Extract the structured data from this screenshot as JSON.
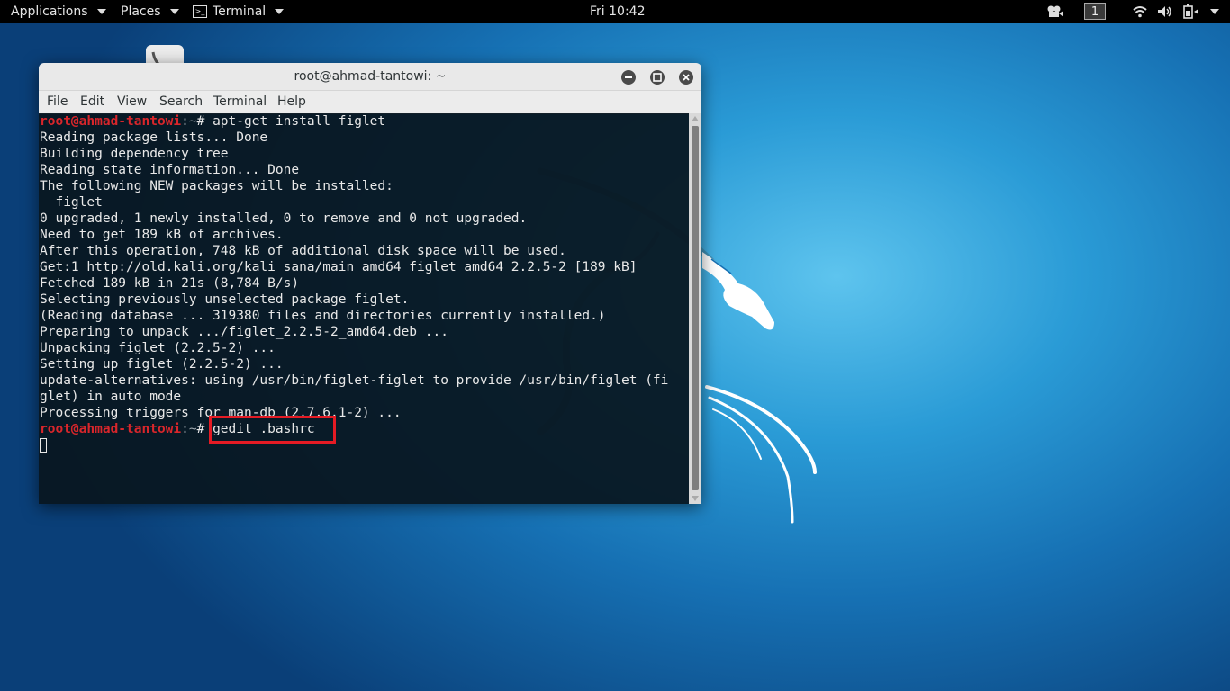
{
  "topbar": {
    "applications": "Applications",
    "places": "Places",
    "terminal": "Terminal",
    "clock": "Fri 10:42",
    "workspace": "1"
  },
  "window": {
    "title": "root@ahmad-tantowi: ~",
    "menu": [
      "File",
      "Edit",
      "View",
      "Search",
      "Terminal",
      "Help"
    ]
  },
  "terminal": {
    "prompt_user": "root@ahmad-tantowi",
    "prompt_sep": ":~",
    "prompt_hash": "# ",
    "command1": "apt-get install figlet",
    "output": [
      "Reading package lists... Done",
      "Building dependency tree",
      "Reading state information... Done",
      "The following NEW packages will be installed:",
      "  figlet",
      "0 upgraded, 1 newly installed, 0 to remove and 0 not upgraded.",
      "Need to get 189 kB of archives.",
      "After this operation, 748 kB of additional disk space will be used.",
      "Get:1 http://old.kali.org/kali sana/main amd64 figlet amd64 2.2.5-2 [189 kB]",
      "Fetched 189 kB in 21s (8,784 B/s)",
      "Selecting previously unselected package figlet.",
      "(Reading database ... 319380 files and directories currently installed.)",
      "Preparing to unpack .../figlet_2.2.5-2_amd64.deb ...",
      "Unpacking figlet (2.2.5-2) ...",
      "Setting up figlet (2.2.5-2) ...",
      "update-alternatives: using /usr/bin/figlet-figlet to provide /usr/bin/figlet (fi",
      "glet) in auto mode",
      "Processing triggers for man-db (2.7.6.1-2) ..."
    ],
    "command2": "gedit .bashrc"
  },
  "colors": {
    "prompt": "#d9262b",
    "highlight": "#e51b24"
  }
}
